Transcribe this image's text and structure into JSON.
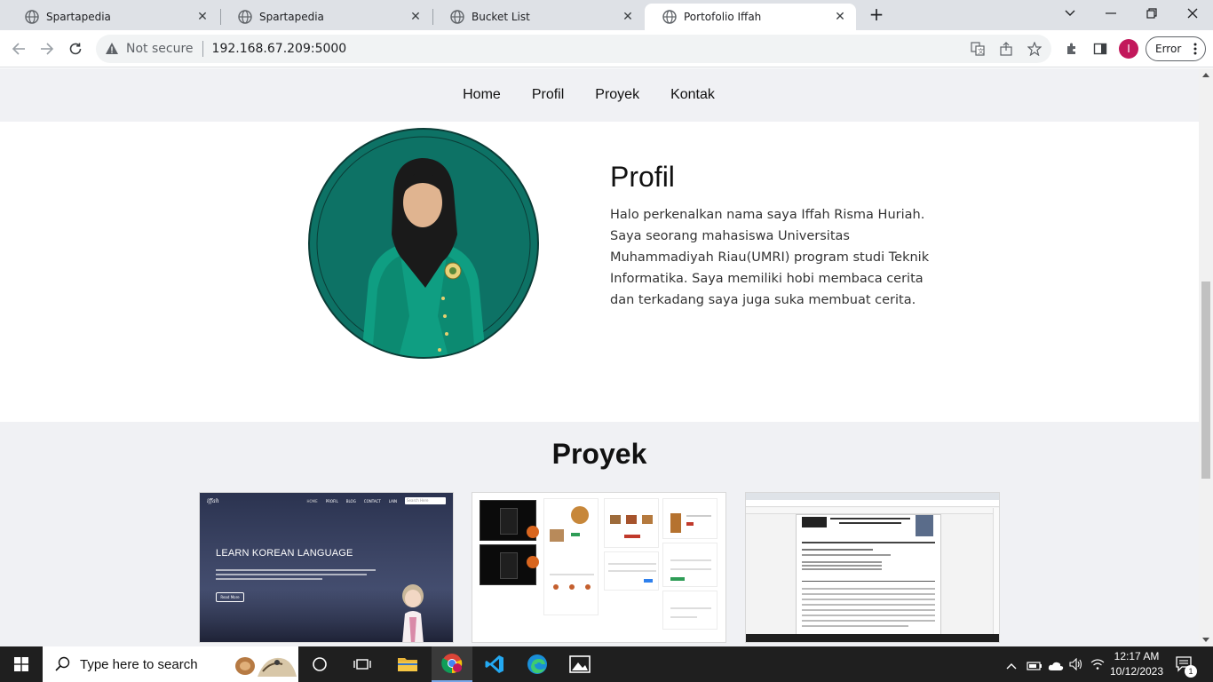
{
  "browser": {
    "tabs": [
      {
        "title": "Spartapedia",
        "active": false
      },
      {
        "title": "Spartapedia",
        "active": false
      },
      {
        "title": "Bucket List",
        "active": false
      },
      {
        "title": "Portofolio Iffah",
        "active": true
      }
    ],
    "security_label": "Not secure",
    "url": "192.168.67.209:5000",
    "profile_initial": "I",
    "error_label": "Error"
  },
  "site": {
    "nav": [
      "Home",
      "Profil",
      "Proyek",
      "Kontak"
    ],
    "profile": {
      "title": "Profil",
      "text": "Halo perkenalkan nama saya Iffah Risma Huriah. Saya seorang mahasiswa Universitas Muhammadiyah Riau(UMRI) program studi Teknik Informatika. Saya memiliki hobi membaca cerita dan terkadang saya juga suka membuat cerita."
    },
    "projects": {
      "title": "Proyek",
      "card1": {
        "logo": "iffah",
        "nav": [
          "HOME",
          "PROFIL",
          "BLOG",
          "CONTACT",
          "LAIN"
        ],
        "search_placeholder": "Search Here",
        "title": "LEARN KOREAN LANGUAGE",
        "button": "Read More"
      }
    }
  },
  "taskbar": {
    "search_placeholder": "Type here to search",
    "time": "12:17 AM",
    "date": "10/12/2023",
    "notification_count": "1"
  },
  "colors": {
    "accent": "#c2185b",
    "profile_bg": "#0d7265",
    "section_bg": "#f0f1f4"
  }
}
